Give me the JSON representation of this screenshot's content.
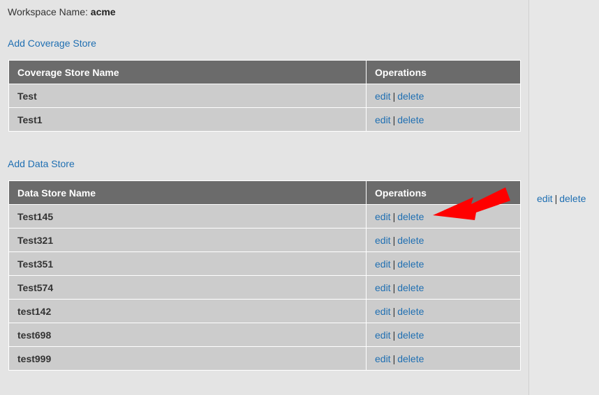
{
  "workspace": {
    "label": "Workspace Name: ",
    "name": "acme"
  },
  "coverage": {
    "add_link": "Add Coverage Store",
    "headers": [
      "Coverage Store Name",
      "Operations"
    ],
    "rows": [
      {
        "name": "Test"
      },
      {
        "name": "Test1"
      }
    ]
  },
  "datastore": {
    "add_link": "Add Data Store",
    "headers": [
      "Data Store Name",
      "Operations"
    ],
    "rows": [
      {
        "name": "Test145"
      },
      {
        "name": "Test321"
      },
      {
        "name": "Test351"
      },
      {
        "name": "Test574"
      },
      {
        "name": "test142"
      },
      {
        "name": "test698"
      },
      {
        "name": "test999"
      }
    ]
  },
  "ops": {
    "edit": "edit",
    "sep": "|",
    "delete": "delete"
  },
  "colors": {
    "link": "#1f6fb2",
    "header_bg": "#6b6b6b",
    "row_bg": "#cccccc",
    "arrow": "#ff0000"
  }
}
